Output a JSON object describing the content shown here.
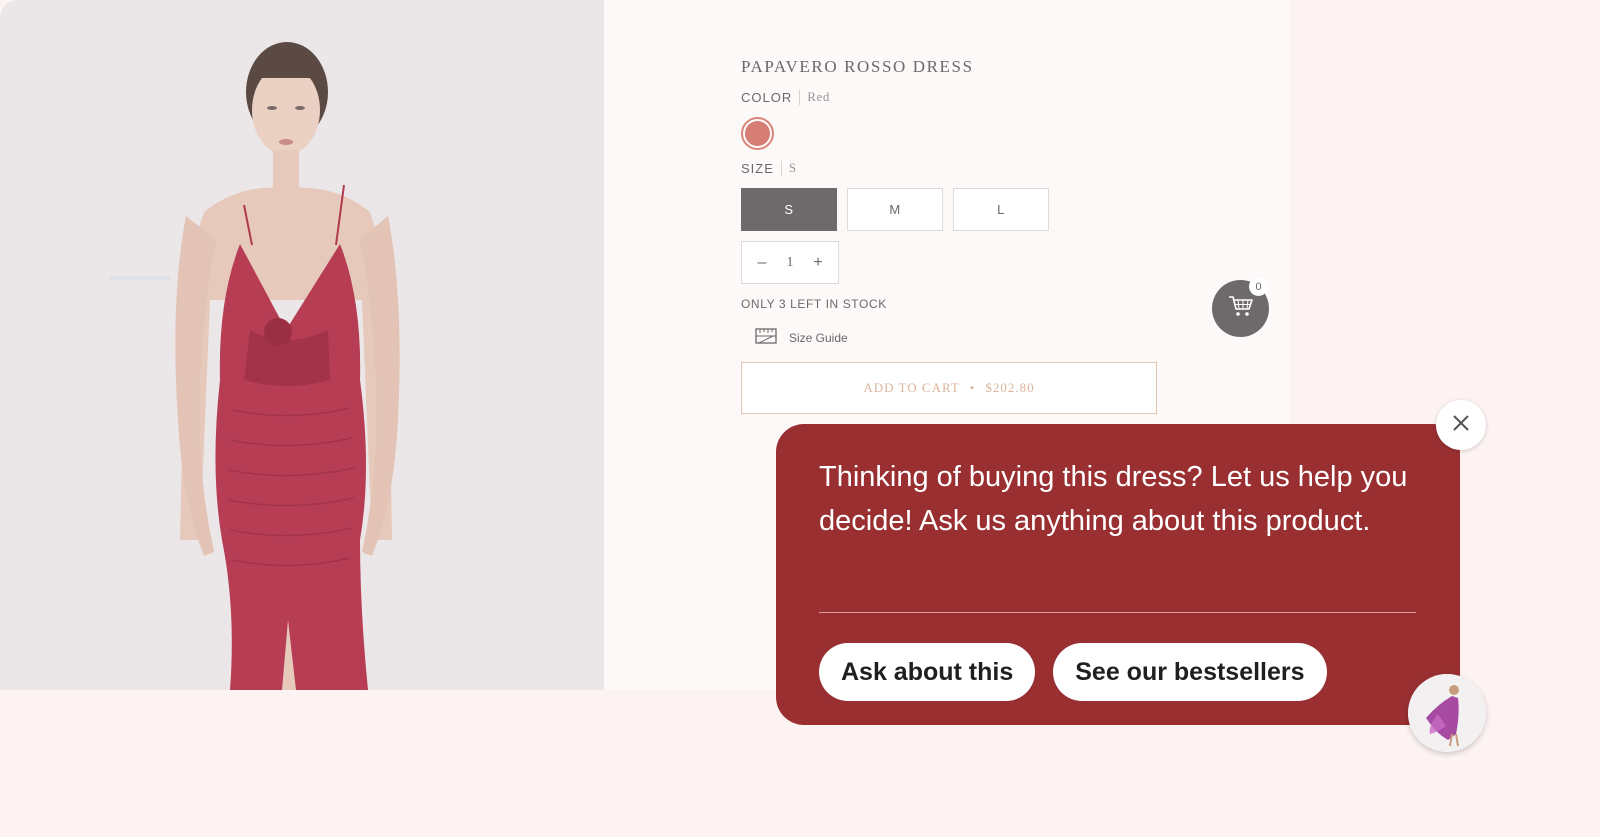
{
  "product": {
    "title": "PAPAVERO ROSSO DRESS",
    "color_label": "COLOR",
    "color_value": "Red",
    "swatch_color": "#d57d74",
    "size_label": "SIZE",
    "size_value": "S",
    "sizes": [
      {
        "label": "S",
        "selected": true
      },
      {
        "label": "M",
        "selected": false
      },
      {
        "label": "L",
        "selected": false
      }
    ],
    "quantity": {
      "minus": "–",
      "value": "1",
      "plus": "+"
    },
    "stock_text": "ONLY 3 LEFT IN STOCK",
    "size_guide": "Size Guide",
    "add_to_cart": {
      "label": "ADD TO CART",
      "dot": "•",
      "price": "$202.80"
    }
  },
  "cart": {
    "count": "0",
    "icon": "cart-icon"
  },
  "popup": {
    "message": "Thinking of buying this dress? Let us help you decide! Ask us anything about this product.",
    "actions": [
      "Ask about this",
      "See our bestsellers"
    ],
    "close_icon": "close-icon",
    "background": "#992f31"
  },
  "colors": {
    "page_bg": "#fdf3f3",
    "text": "#6d6869",
    "accent": "#dcb29b",
    "active_size": "#6e6a6b"
  }
}
